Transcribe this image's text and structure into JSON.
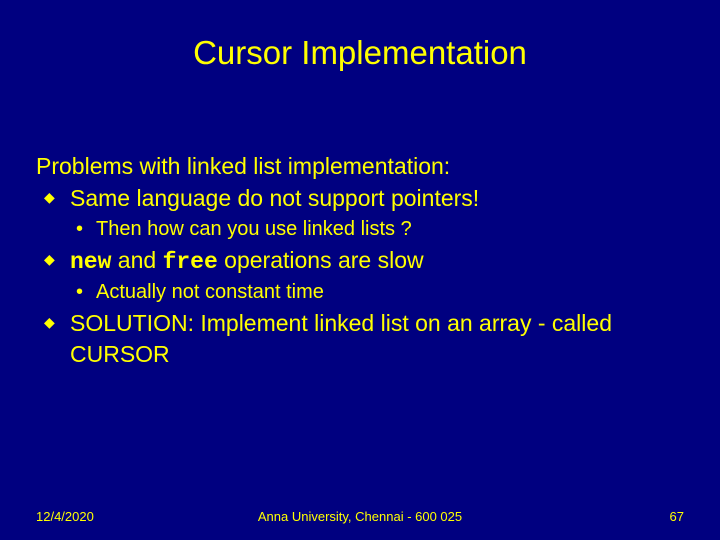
{
  "title": "Cursor Implementation",
  "intro": "Problems with linked list implementation:",
  "bullets": {
    "b1": "Same language do not support pointers!",
    "b1_sub": "Then how can you use linked lists ?",
    "b2_pre": "new",
    "b2_mid": " and ",
    "b2_mono2": "free",
    "b2_post": " operations are slow",
    "b2_sub": "Actually not constant time",
    "b3": "SOLUTION: Implement linked list on an array - called CURSOR"
  },
  "footer": {
    "date": "12/4/2020",
    "org": "Anna University, Chennai - 600 025",
    "page": "67"
  }
}
